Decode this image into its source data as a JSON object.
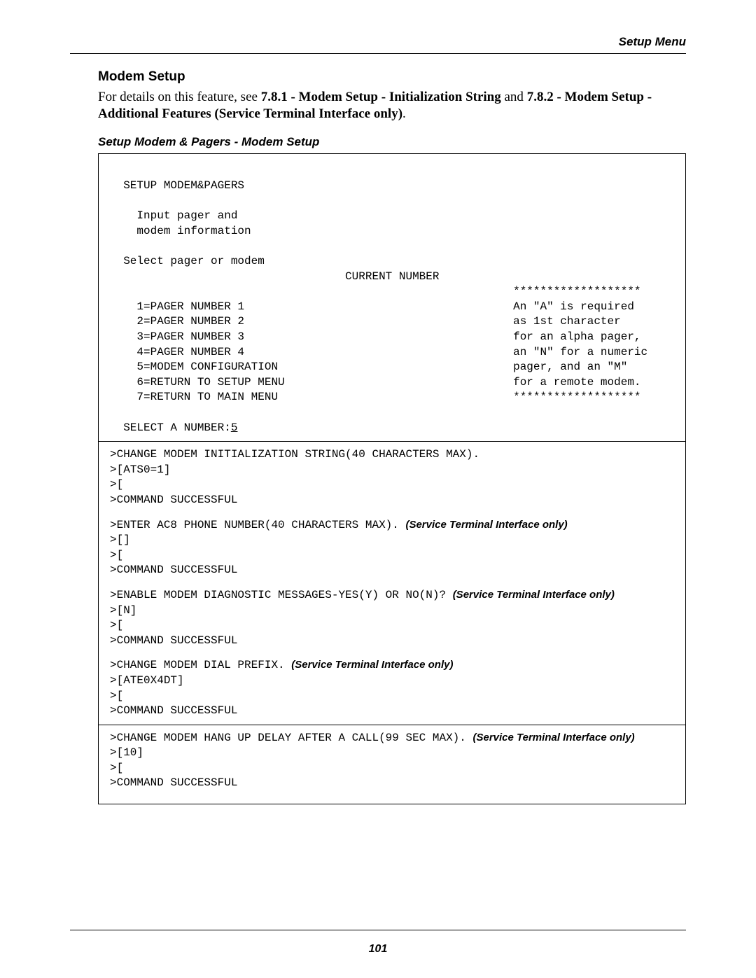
{
  "header": {
    "name": "Setup Menu"
  },
  "section": {
    "title": "Modem Setup",
    "intro_pre": "For details on this feature, see ",
    "intro_b1": "7.8.1 - Modem Setup - Initialization String",
    "intro_mid": " and ",
    "intro_b2": "7.8.2 - Modem Setup - Additional Features (Service Terminal Interface only)",
    "intro_post": ".",
    "caption": "Setup Modem & Pagers - Modem Setup"
  },
  "term": {
    "line_title": "  SETUP MODEM&PAGERS",
    "blank1": " ",
    "line_input1": "    Input pager and",
    "line_input2": "    modem information",
    "blank2": " ",
    "line_select": "  Select pager or modem",
    "line_current": "                                   CURRENT NUMBER",
    "star_top": "                                                            *******************",
    "opt1": "    1=PAGER NUMBER 1                                        An \"A\" is required",
    "opt2": "    2=PAGER NUMBER 2                                        as 1st character",
    "opt3": "    3=PAGER NUMBER 3                                        for an alpha pager,",
    "opt4": "    4=PAGER NUMBER 4                                        an \"N\" for a numeric",
    "opt5": "    5=MODEM CONFIGURATION                                   pager, and an \"M\"",
    "opt6": "    6=RETURN TO SETUP MENU                                  for a remote modem.",
    "opt7": "    7=RETURN TO MAIN MENU                                   *******************",
    "blank3": " ",
    "sel_label": "  SELECT A NUMBER:",
    "sel_value": "5",
    "b1_l1": ">CHANGE MODEM INITIALIZATION STRING(40 CHARACTERS MAX).",
    "b1_l2": ">[ATS0=1]",
    "b1_l3": ">[",
    "b1_l4": ">COMMAND SUCCESSFUL",
    "b2_l1_pre": ">ENTER AC8 PHONE NUMBER(40 CHARACTERS MAX). ",
    "svc_note": "(Service Terminal Interface only)",
    "b2_l2": ">[]",
    "b2_l3": ">[",
    "b2_l4": ">COMMAND SUCCESSFUL",
    "b3_l1_pre": ">ENABLE MODEM DIAGNOSTIC MESSAGES-YES(Y) OR NO(N)? ",
    "b3_l2": ">[N]",
    "b3_l3": ">[",
    "b3_l4": ">COMMAND SUCCESSFUL",
    "b4_l1_pre": ">CHANGE MODEM DIAL PREFIX. ",
    "b4_l2": ">[ATE0X4DT]",
    "b4_l3": ">[",
    "b4_l4": ">COMMAND SUCCESSFUL",
    "b5_l1_pre": ">CHANGE MODEM HANG UP DELAY AFTER A CALL(99 SEC MAX). ",
    "b5_l2": ">[10]",
    "b5_l3": ">[",
    "b5_l4": ">COMMAND SUCCESSFUL"
  },
  "footer": {
    "page": "101"
  }
}
